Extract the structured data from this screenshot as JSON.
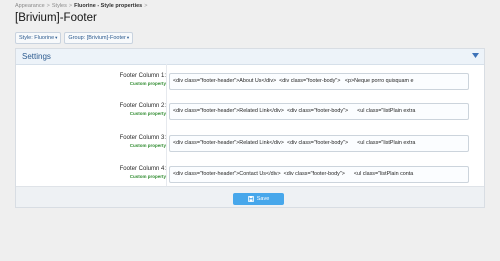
{
  "breadcrumb": [
    {
      "label": "Appearance"
    },
    {
      "label": "Styles"
    },
    {
      "label": "Fluorine - Style properties"
    }
  ],
  "breadcrumb_separator": ">",
  "page": {
    "title": "[Brivium]-Footer"
  },
  "filters": {
    "style_label": "Style: Fluorine",
    "group_label": "Group: [Brivium]-Footer"
  },
  "panel": {
    "title": "Settings",
    "toggle_icon": "chevron-down-icon",
    "rows": [
      {
        "label": "Footer Column 1:",
        "hint": "Custom property",
        "value": "<div class=\"footer-header\">About Us</div>  <div class=\"footer-body\">   <p>Neque porro quisquam e"
      },
      {
        "label": "Footer Column 2:",
        "hint": "Custom property",
        "value": "<div class=\"footer-header\">Related Link</div>  <div class=\"footer-body\">      <ul class=\"listPlain extra"
      },
      {
        "label": "Footer Column 3:",
        "hint": "Custom property",
        "value": "<div class=\"footer-header\">Related Link</div>  <div class=\"footer-body\">      <ul class=\"listPlain extra"
      },
      {
        "label": "Footer Column 4:",
        "hint": "Custom property",
        "value": "<div class=\"footer-header\">Contact Us</div>  <div class=\"footer-body\">      <ul class=\"listPlain conta"
      }
    ]
  },
  "save_button": {
    "label": "Save",
    "icon": "save-icon"
  },
  "colors": {
    "accent": "#47a7eb",
    "link": "#2b5a8f",
    "hint": "#2e8b2e"
  }
}
